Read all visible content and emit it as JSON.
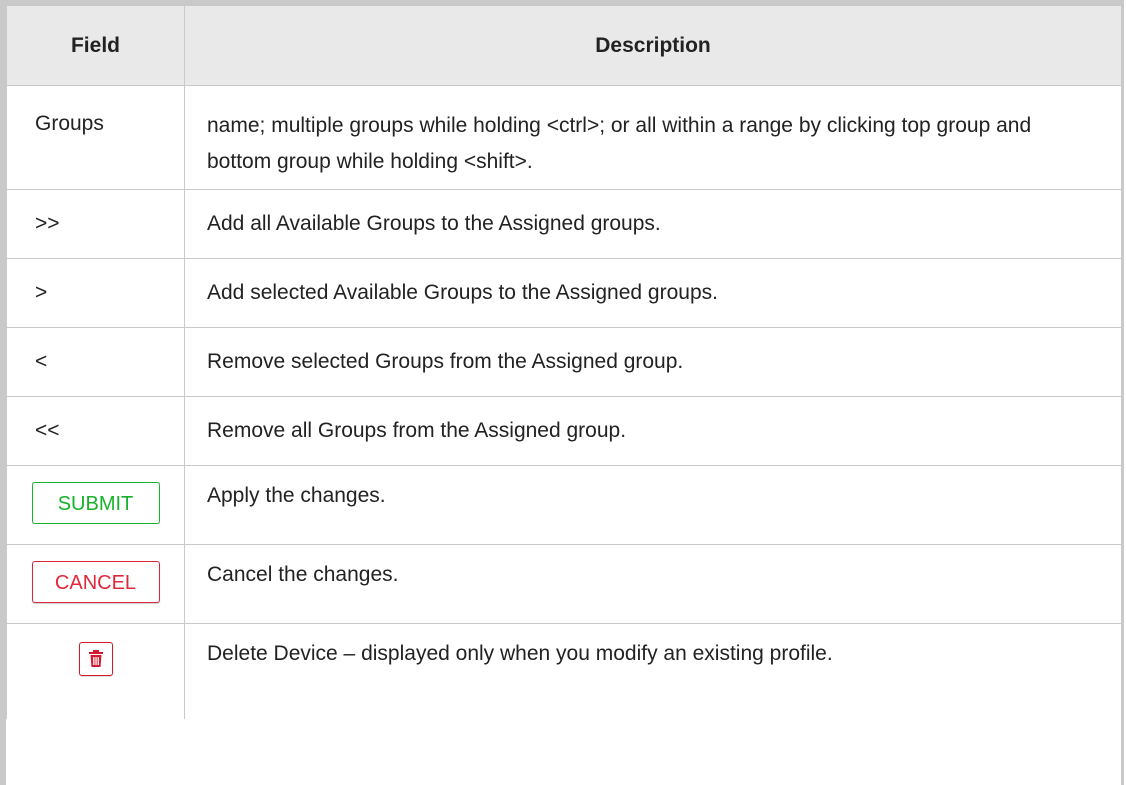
{
  "table": {
    "headers": {
      "field": "Field",
      "description": "Description"
    },
    "rows": [
      {
        "field": "Groups",
        "description": "name; multiple groups while holding <ctrl>; or all within a range by clicking top group and bottom group while holding <shift>."
      },
      {
        "field": ">>",
        "description": "Add all Available Groups to the Assigned groups."
      },
      {
        "field": ">",
        "description": "Add selected Available Groups to the Assigned groups."
      },
      {
        "field": "<",
        "description": "Remove selected Groups from the Assigned group."
      },
      {
        "field": "<<",
        "description": "Remove all Groups from the Assigned group."
      },
      {
        "field_button": "SUBMIT",
        "description": "Apply the changes."
      },
      {
        "field_button": "CANCEL",
        "description": "Cancel the changes."
      },
      {
        "field_icon": "trash-icon",
        "description": "Delete Device – displayed only when you modify an existing profile."
      }
    ]
  },
  "colors": {
    "submit": "#17b22a",
    "cancel": "#e0283d",
    "delete": "#d3192b",
    "header_bg": "#e9e9e9",
    "border": "#c9c9c9"
  }
}
